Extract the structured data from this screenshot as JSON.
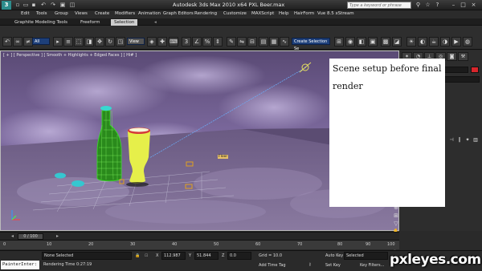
{
  "titlebar": {
    "title": "Autodesk 3ds Max  2010 x64     PXL Beer.max",
    "search_placeholder": "Type a keyword or phrase",
    "app_logo": "3ds-max-logo"
  },
  "menu": [
    "Edit",
    "Tools",
    "Group",
    "Views",
    "Create",
    "Modifiers",
    "Animation",
    "Graph Editors",
    "Rendering",
    "Customize",
    "MAXScript",
    "Help",
    "HairForm",
    "Vue 8.5 xStream"
  ],
  "ribbon": {
    "label": "Graphite Modeling Tools",
    "tabs": [
      "Freeform",
      "Selection"
    ],
    "active_tab": "Selection"
  },
  "toolbar": {
    "filter_dropdown": "All",
    "view_dropdown": "View",
    "selection_set": "Create Selection Se"
  },
  "viewport": {
    "label": "[ + ] [ Perspective ] [ Smooth + Highlights + Edged Faces ] [ Hi# ]",
    "floor_tag": "Floor"
  },
  "annotation": {
    "text": "Scene setup before final render"
  },
  "timeline": {
    "slider_label": "0 / 100",
    "ticks": [
      "0",
      "10",
      "20",
      "30",
      "40",
      "50",
      "60",
      "70",
      "80",
      "90",
      "100"
    ]
  },
  "status": {
    "selection": "None Selected",
    "prompt": "Rendering Time  0:27:19",
    "x_label": "X",
    "x_value": "112.987",
    "y_label": "Y",
    "y_value": "51.844",
    "z_label": "Z",
    "z_value": "0.0",
    "grid": "Grid = 10.0",
    "add_time_tag": "Add Time Tag",
    "auto_key": "Auto Key",
    "auto_key_mode": "Selected",
    "set_key": "Set Key",
    "key_filters": "Key Filters...",
    "listener": "PainterInter:"
  },
  "watermark": "pxleyes.com",
  "colors": {
    "wireframe_green": "#2fbf2f",
    "bottle_yellow": "#e8f04a",
    "selection_blue": "#1d3f7a",
    "swatch_red": "#d7262c"
  }
}
